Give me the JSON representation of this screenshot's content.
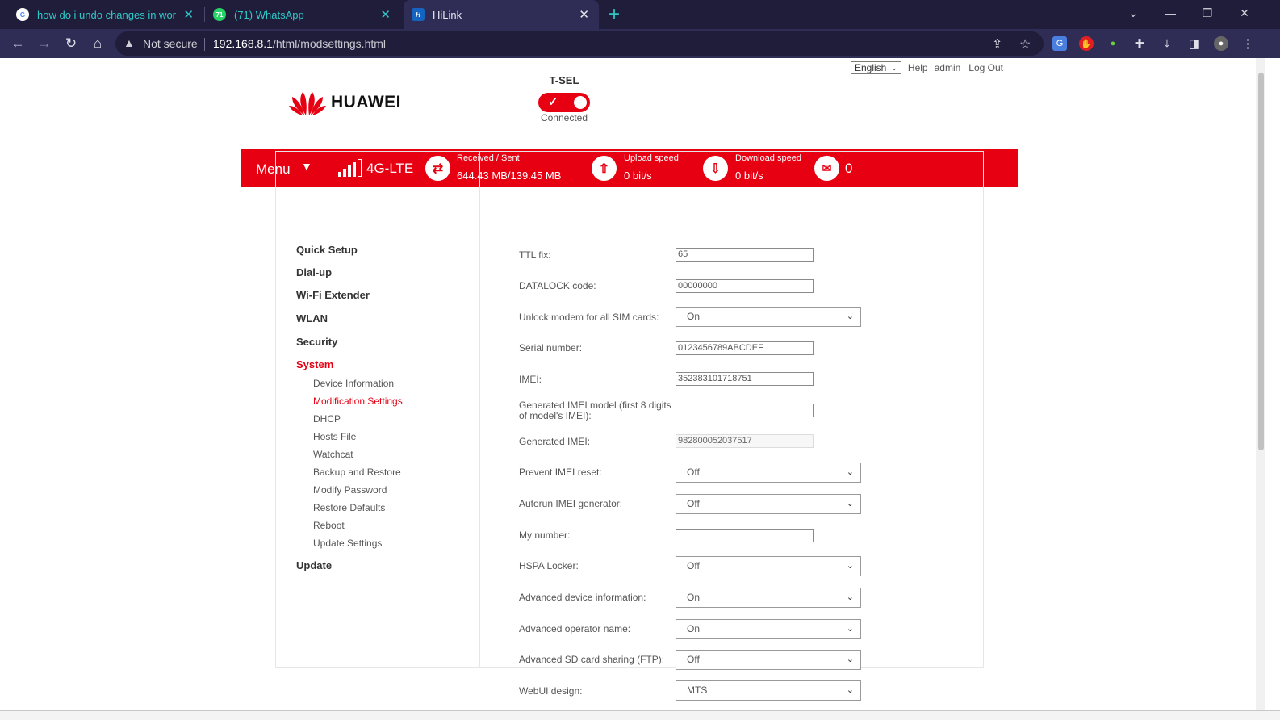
{
  "browser": {
    "tabs": [
      {
        "label": "how do i undo changes in word a",
        "icon": "google-icon"
      },
      {
        "label": "(71) WhatsApp",
        "icon": "whatsapp-icon",
        "badge": "71"
      },
      {
        "label": "HiLink",
        "icon": "hilink-icon",
        "active": true
      }
    ],
    "new_tab": "+",
    "security_label": "Not secure",
    "url_host": "192.168.8.1",
    "url_path": "/html/modsettings.html"
  },
  "header": {
    "language": "English",
    "help": "Help",
    "user": "admin",
    "logout": "Log Out",
    "brand": "HUAWEI",
    "operator": "T-SEL",
    "connection_status": "Connected"
  },
  "statusbar": {
    "menu": "Menu",
    "network": "4G-LTE",
    "received_sent_label": "Received / Sent",
    "received_sent_value": "644.43 MB/139.45 MB",
    "upload_label": "Upload speed",
    "upload_value": "0 bit/s",
    "download_label": "Download speed",
    "download_value": "0 bit/s",
    "messages": "0"
  },
  "sidebar": {
    "main": [
      "Quick Setup",
      "Dial-up",
      "Wi-Fi Extender",
      "WLAN",
      "Security",
      "System",
      "Update"
    ],
    "sub": [
      "Device Information",
      "Modification Settings",
      "DHCP",
      "Hosts File",
      "Watchcat",
      "Backup and Restore",
      "Modify Password",
      "Restore Defaults",
      "Reboot",
      "Update Settings"
    ]
  },
  "form": {
    "ttl_label": "TTL fix:",
    "ttl_value": "65",
    "datalock_label": "DATALOCK code:",
    "datalock_value": "00000000",
    "unlock_label": "Unlock modem for all SIM cards:",
    "unlock_value": "On",
    "serial_label": "Serial number:",
    "serial_value": "0123456789ABCDEF",
    "imei_label": "IMEI:",
    "imei_value": "352383101718751",
    "gen_model_label": "Generated IMEI model (first 8 digits of model's IMEI):",
    "gen_model_value": "",
    "gen_imei_label": "Generated IMEI:",
    "gen_imei_value": "982800052037517",
    "prevent_label": "Prevent IMEI reset:",
    "prevent_value": "Off",
    "autorun_label": "Autorun IMEI generator:",
    "autorun_value": "Off",
    "mynumber_label": "My number:",
    "mynumber_value": "",
    "hspa_label": "HSPA Locker:",
    "hspa_value": "Off",
    "adv_device_label": "Advanced device information:",
    "adv_device_value": "On",
    "adv_operator_label": "Advanced operator name:",
    "adv_operator_value": "On",
    "adv_sd_label": "Advanced SD card sharing (FTP):",
    "adv_sd_value": "Off",
    "webui_label": "WebUI design:",
    "webui_value": "MTS"
  },
  "colors": {
    "brand_red": "#e60012",
    "tab_accent": "#2ec8c8",
    "chrome_dark": "#1f1d3a",
    "chrome_mid": "#2f2d55"
  }
}
